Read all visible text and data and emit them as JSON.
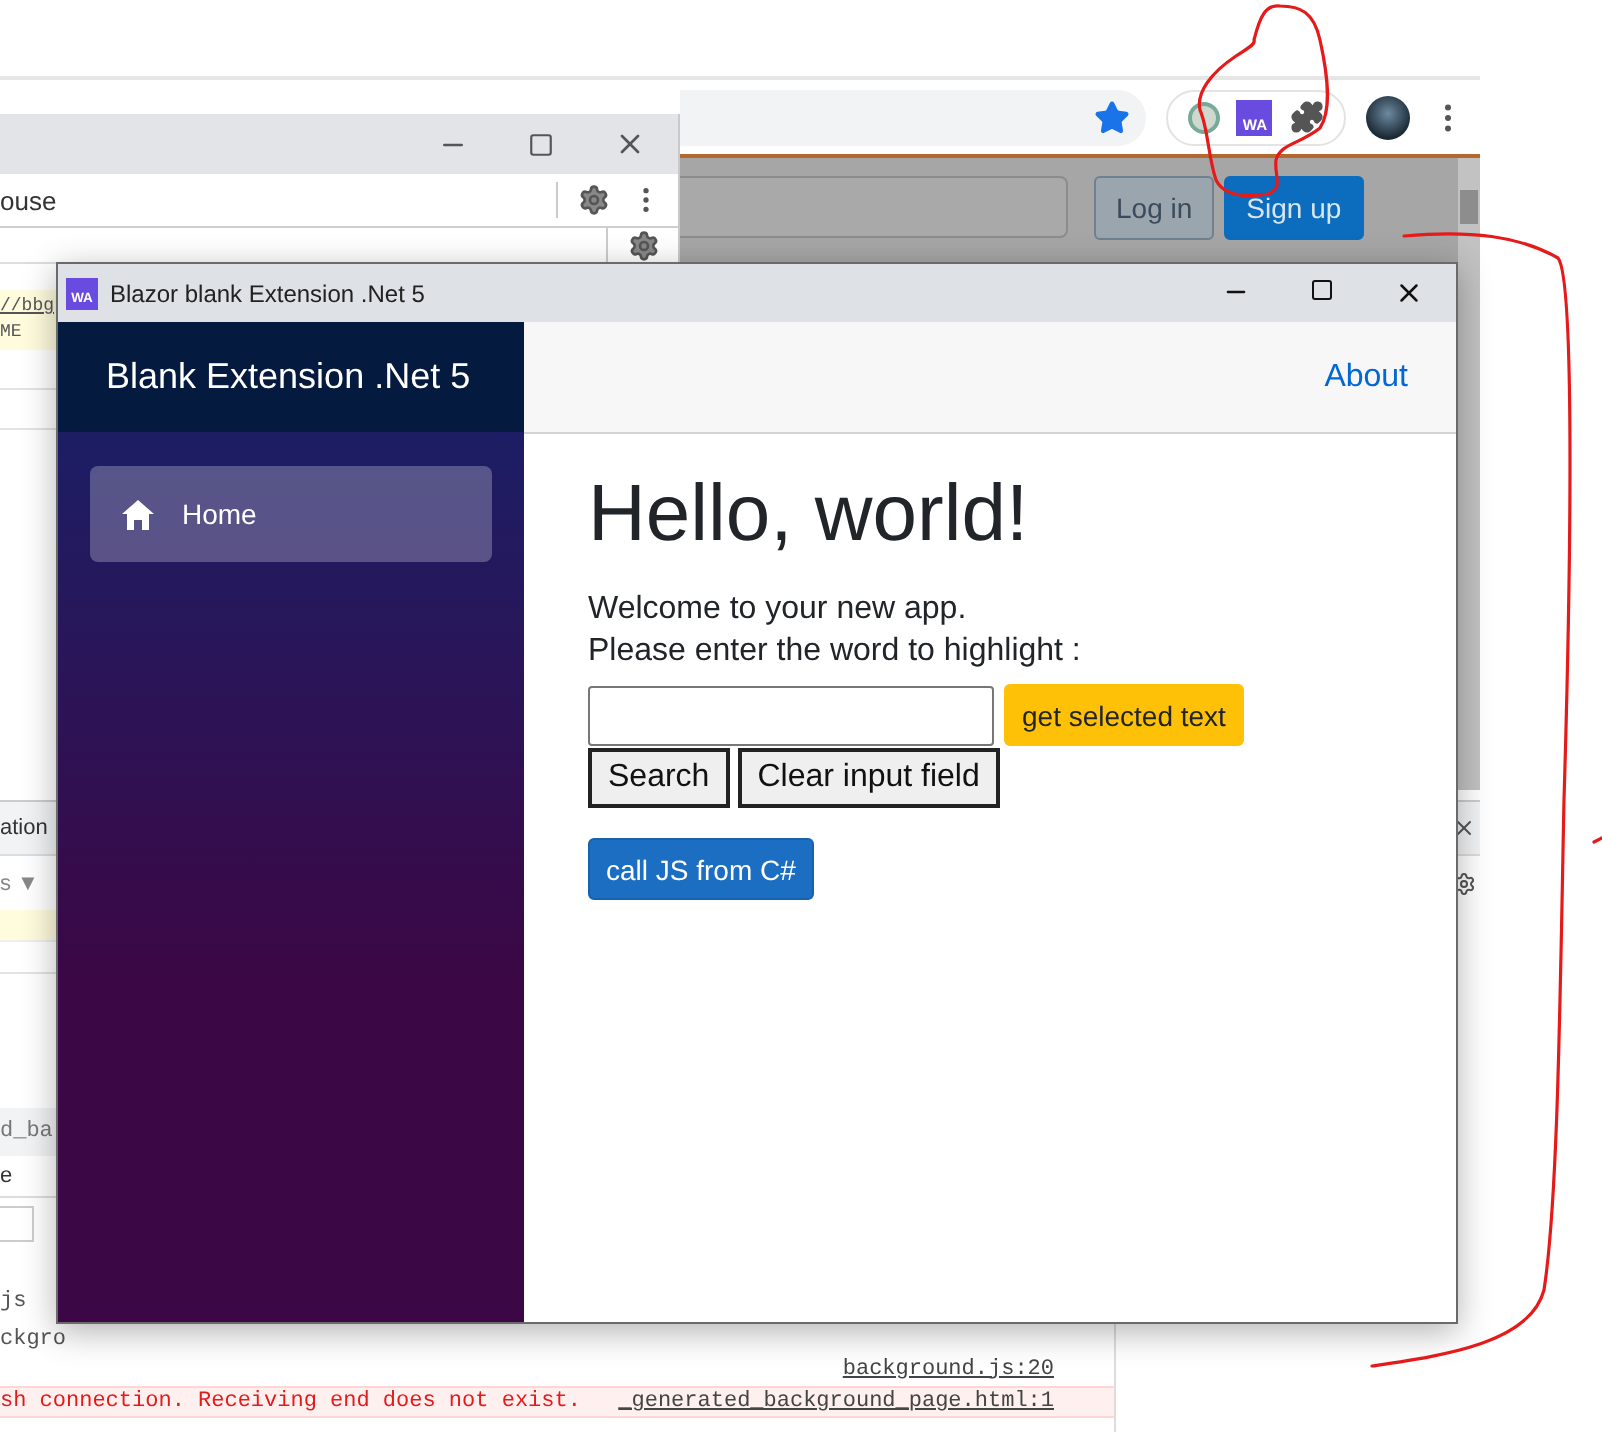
{
  "browser": {
    "extension_badge": "WA",
    "auth_buttons": [
      {
        "label": "Log in",
        "kind": "outline"
      },
      {
        "label": "Sign up",
        "kind": "primary"
      }
    ]
  },
  "devtools": {
    "toolbar_text": "ouse",
    "source_lines": [
      "//bbg",
      "ME"
    ]
  },
  "devtools_drawer": {
    "tab_text": "ation",
    "filter_text": "s ▼",
    "file_tab": "d_ba",
    "label_text": "e",
    "tree_items": [
      "js",
      "ckgro"
    ],
    "console": [
      {
        "kind": "log",
        "source": "background.js:20"
      },
      {
        "kind": "error",
        "text": "sh connection. Receiving end does not exist.",
        "source": "_generated_background_page.html:1"
      }
    ]
  },
  "app_window": {
    "badge": "WA",
    "title": "Blazor blank Extension .Net 5",
    "brand": "Blank Extension .Net 5",
    "nav": [
      {
        "label": "Home",
        "selected": true
      }
    ],
    "top_link": "About",
    "heading": "Hello, world!",
    "lines": [
      "Welcome to your new app.",
      "Please enter the word to highlight :"
    ],
    "actions": [
      {
        "label": "get selected text",
        "kind": "warning"
      },
      {
        "label": "Search",
        "kind": "plain"
      },
      {
        "label": "Clear input field",
        "kind": "plain"
      },
      {
        "label": "call JS from C#",
        "kind": "primary"
      }
    ]
  }
}
